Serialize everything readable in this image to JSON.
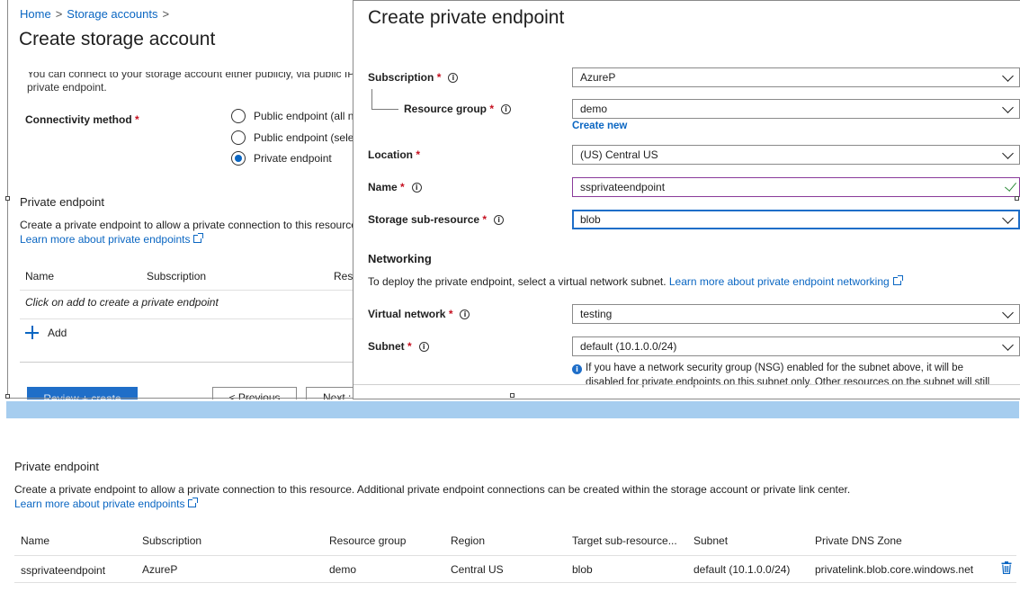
{
  "breadcrumb": {
    "home": "Home",
    "storage_accounts": "Storage accounts",
    "separator": ">"
  },
  "create_storage": {
    "title": "Create storage account",
    "intro_cut": "You can connect to your storage account either publicly, via public IP",
    "intro_line2": "private endpoint.",
    "connectivity_label": "Connectivity method",
    "required_mark": "*",
    "options": [
      {
        "label": "Public endpoint (all n",
        "checked": false
      },
      {
        "label": "Public endpoint (sele",
        "checked": false
      },
      {
        "label": "Private endpoint",
        "checked": true
      }
    ],
    "private_endpoint_title": "Private endpoint",
    "private_endpoint_desc": "Create a private endpoint to allow a private connection to this resource",
    "learn_more": "Learn more about private endpoints",
    "table_headers": [
      "Name",
      "Subscription",
      "Res"
    ],
    "empty_text": "Click on add to create a private endpoint",
    "add_label": "Add",
    "buttons": {
      "review": "Review + create",
      "previous": "< Previous",
      "next": "Next :"
    }
  },
  "create_pe": {
    "title": "Create private endpoint",
    "subscription": {
      "label": "Subscription",
      "value": "AzureP"
    },
    "resource_group": {
      "label": "Resource group",
      "value": "demo",
      "create_new": "Create new"
    },
    "location": {
      "label": "Location",
      "value": "(US) Central US"
    },
    "name": {
      "label": "Name",
      "value": "ssprivateendpoint"
    },
    "sub_resource": {
      "label": "Storage sub-resource",
      "value": "blob"
    },
    "networking_title": "Networking",
    "networking_desc": "To deploy the private endpoint, select a virtual network subnet.",
    "networking_link": "Learn more about private endpoint networking",
    "virtual_network": {
      "label": "Virtual network",
      "value": "testing"
    },
    "subnet": {
      "label": "Subnet",
      "value": "default (10.1.0.0/24)"
    },
    "note_line1": "If you have a network security group (NSG) enabled for the subnet above, it will be",
    "note_line2": "disabled for private endpoints on this subnet only. Other resources on the subnet will still"
  },
  "bottom": {
    "title": "Private endpoint",
    "desc": "Create a private endpoint to allow a private connection to this resource. Additional private endpoint connections can be created within the storage account or private link center.",
    "learn_more": "Learn more about private endpoints",
    "headers": [
      "Name",
      "Subscription",
      "Resource group",
      "Region",
      "Target sub-resource...",
      "Subnet",
      "Private DNS Zone"
    ],
    "row": {
      "name": "ssprivateendpoint",
      "subscription": "AzureP",
      "resource_group": "demo",
      "region": "Central US",
      "target": "blob",
      "subnet": "default (10.1.0.0/24)",
      "dns_zone": "privatelink.blob.core.windows.net"
    }
  },
  "colors": {
    "accent": "#0a66c2",
    "required": "#c50f1f",
    "divider": "#a6cdef"
  },
  "icons": [
    "info-icon",
    "chevron-down-icon",
    "checkmark-icon",
    "external-link-icon",
    "plus-icon",
    "trash-icon"
  ]
}
